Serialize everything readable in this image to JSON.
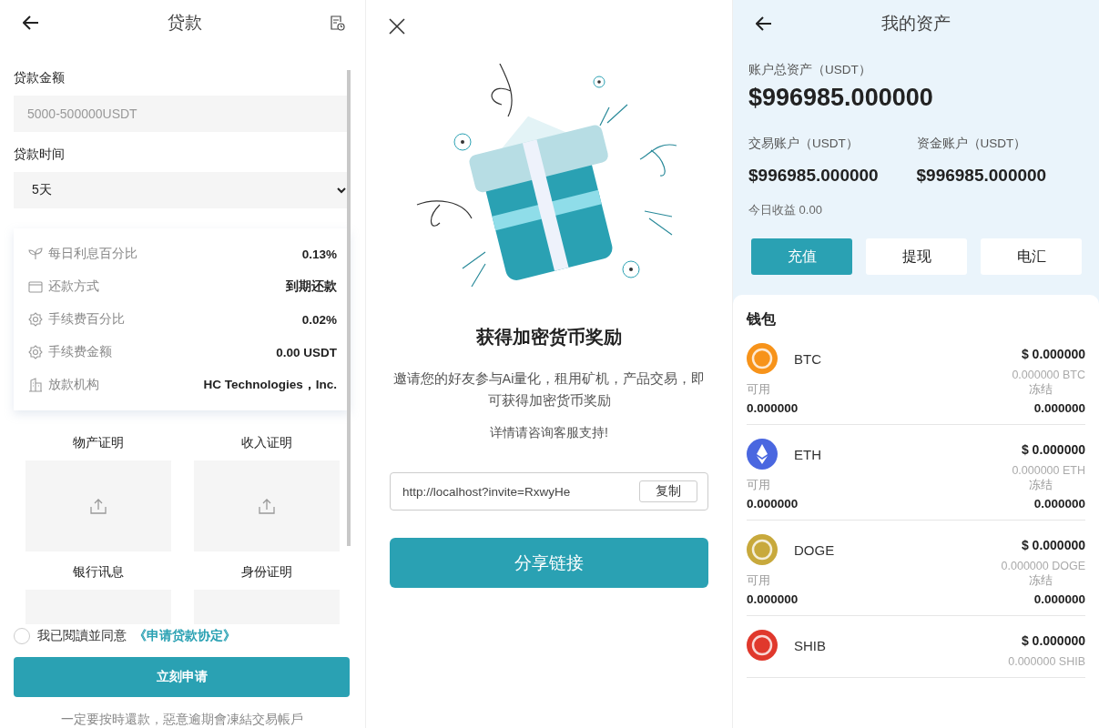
{
  "loan": {
    "title": "贷款",
    "amount": {
      "label": "贷款金额",
      "placeholder": "5000-500000USDT"
    },
    "term": {
      "label": "贷款时间",
      "value": "5天"
    },
    "details": [
      {
        "kind": "rate",
        "label": "每日利息百分比",
        "value": "0.13%"
      },
      {
        "kind": "repayment",
        "label": "还款方式",
        "value": "到期还款"
      },
      {
        "kind": "fee",
        "label": "手续费百分比",
        "value": "0.02%"
      },
      {
        "kind": "fee",
        "label": "手续费金额",
        "value": "0.00 USDT"
      },
      {
        "kind": "lender",
        "label": "放款机构",
        "value": "HC Technologies，Inc."
      }
    ],
    "uploads": [
      {
        "label": "物产证明"
      },
      {
        "label": "收入证明"
      },
      {
        "label": "银行讯息"
      },
      {
        "label": "身份证明"
      }
    ],
    "agreement": {
      "checked": false,
      "text": "我已閱讀並同意",
      "link": "《申请贷款协定》"
    },
    "submit": "立刻申请",
    "notice": "一定要按時還款，惡意逾期會凍結交易帳戶"
  },
  "invite": {
    "title": "获得加密货币奖励",
    "description": "邀请您的好友参与Ai量化，租用矿机，产品交易，即可获得加密货币奖励",
    "note": "详情请咨询客服支持!",
    "link": "http://localhost?invite=RxwyHe",
    "copy": "复制",
    "share": "分享链接"
  },
  "assets": {
    "title": "我的资产",
    "total_label": "账户总资产（USDT）",
    "total": "$996985.000000",
    "accounts": [
      {
        "label": "交易账户（USDT）",
        "value": "$996985.000000"
      },
      {
        "label": "资金账户（USDT）",
        "value": "$996985.000000"
      }
    ],
    "today": "今日收益 0.00",
    "actions": [
      {
        "label": "充值",
        "selected": true
      },
      {
        "label": "提现",
        "selected": false
      },
      {
        "label": "电汇",
        "selected": false
      }
    ],
    "wallet_title": "钱包",
    "coins": [
      {
        "symbol": "BTC",
        "color": "#f7931a",
        "usd": "$ 0.000000",
        "amount": "0.000000 BTC",
        "available_label": "可用",
        "available": "0.000000",
        "frozen_label": "冻结",
        "frozen": "0.000000"
      },
      {
        "symbol": "ETH",
        "color": "#4a67e0",
        "usd": "$ 0.000000",
        "amount": "0.000000 ETH",
        "available_label": "可用",
        "available": "0.000000",
        "frozen_label": "冻结",
        "frozen": "0.000000"
      },
      {
        "symbol": "DOGE",
        "color": "#c8a93c",
        "usd": "$ 0.000000",
        "amount": "0.000000 DOGE",
        "available_label": "可用",
        "available": "0.000000",
        "frozen_label": "冻结",
        "frozen": "0.000000"
      },
      {
        "symbol": "SHIB",
        "color": "#e0382c",
        "usd": "$ 0.000000",
        "amount": "0.000000 SHIB"
      }
    ]
  }
}
